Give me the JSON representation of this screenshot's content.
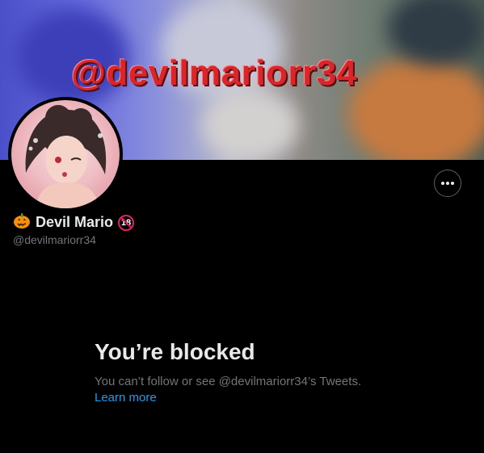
{
  "profile": {
    "banner_text": "@devilmariorr34",
    "display_name": "Devil Mario",
    "handle": "@devilmariorr34",
    "leading_emoji": "🎃",
    "badge_text": "18"
  },
  "blocked": {
    "title": "You’re blocked",
    "description": "You can’t follow or see @devilmariorr34’s Tweets.",
    "learn_more": "Learn more"
  },
  "colors": {
    "background": "#000000",
    "primary_text": "#e7e9ea",
    "secondary_text": "#71767b",
    "link": "#1d9bf0",
    "banner_text": "#d8262a",
    "badge": "#e0245e"
  },
  "icons": {
    "more": "more-horizontal-icon",
    "pumpkin": "pumpkin-emoji-icon",
    "no_under_18": "no-under-18-icon"
  }
}
